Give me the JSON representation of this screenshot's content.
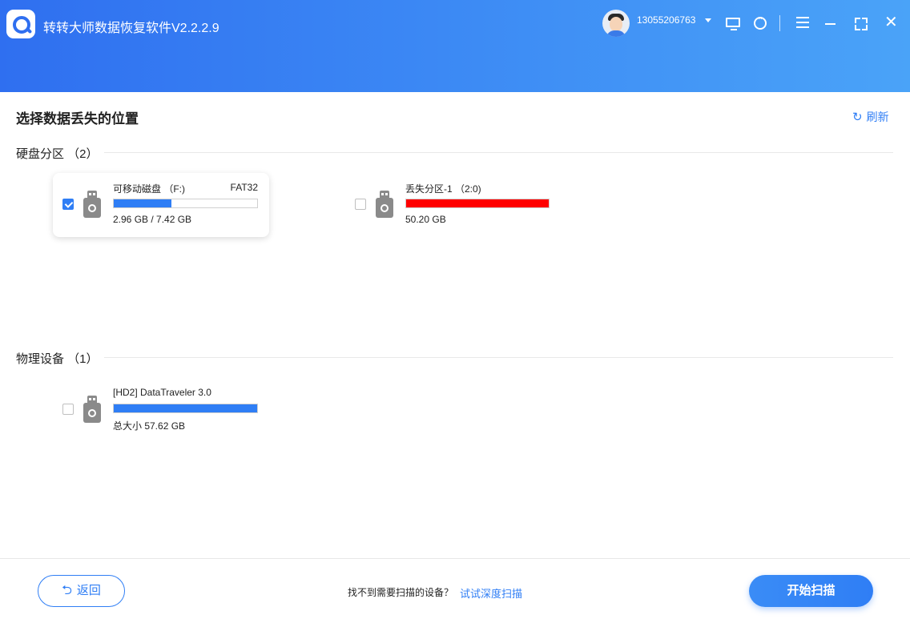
{
  "app": {
    "title": "转转大师数据恢复软件V2.2.2.9",
    "username": "13055206763"
  },
  "page": {
    "title": "选择数据丢失的位置",
    "refresh_label": "刷新"
  },
  "partitions": {
    "header": "硬盘分区 （2）",
    "items": [
      {
        "name": "可移动磁盘 （F:)",
        "fs": "FAT32",
        "size": "2.96 GB / 7.42 GB",
        "used_fraction": 0.4,
        "bar_color": "#2f7ef5",
        "checked": true
      },
      {
        "name": "丢失分区-1 （2:0)",
        "fs": "",
        "size": "50.20 GB",
        "used_fraction": 1.0,
        "bar_color": "#ff0000",
        "checked": false
      }
    ]
  },
  "devices": {
    "header": "物理设备 （1）",
    "items": [
      {
        "name": "[HD2] DataTraveler 3.0",
        "size": "总大小 57.62 GB",
        "used_fraction": 1.0,
        "bar_color": "#2f7ef5",
        "checked": false
      }
    ]
  },
  "footer": {
    "back_label": "返回",
    "hint": "找不到需要扫描的设备？",
    "deep_scan_label": "试试深度扫描",
    "start_label": "开始扫描"
  }
}
